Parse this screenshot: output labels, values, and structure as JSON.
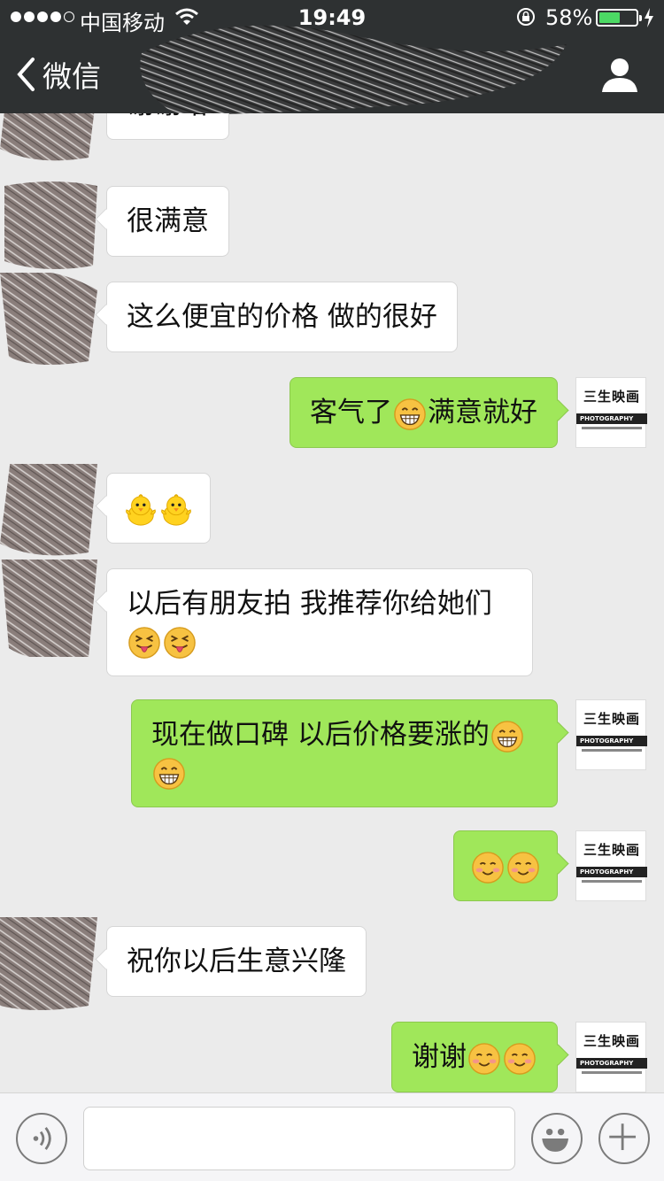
{
  "status": {
    "carrier": "中国移动",
    "time": "19:49",
    "battery_pct": "58%",
    "battery_level": 0.58
  },
  "nav": {
    "back_label": "微信"
  },
  "colors": {
    "nav_bg": "#2e3132",
    "chat_bg": "#ebebeb",
    "bubble_sent": "#a0e75a",
    "bubble_received": "#ffffff"
  },
  "contact_avatar": {
    "logo_title": "三生映画",
    "logo_band": "PHOTOGRAPHY"
  },
  "messages": [
    {
      "side": "left",
      "text": "谢谢哈",
      "emojis": []
    },
    {
      "side": "left",
      "text": "很满意",
      "emojis": []
    },
    {
      "side": "left",
      "text": "这么便宜的价格 做的很好",
      "emojis": []
    },
    {
      "side": "right",
      "text": "客气了",
      "emojis": [
        "grin-icon"
      ],
      "text_after": "满意就好"
    },
    {
      "side": "left",
      "text": "",
      "emojis": [
        "chick-icon",
        "chick-icon"
      ]
    },
    {
      "side": "left",
      "text": " 以后有朋友拍 我推荐你给她们",
      "emojis": [
        "tongue-out-icon",
        "tongue-out-icon"
      ]
    },
    {
      "side": "right",
      "text": "现在做口碑 以后价格要涨的",
      "emojis": [
        "grin-icon",
        "grin-icon"
      ]
    },
    {
      "side": "right",
      "text": "",
      "emojis": [
        "smile-blush-icon",
        "smile-blush-icon"
      ]
    },
    {
      "side": "left",
      "text": " 祝你以后生意兴隆",
      "emojis": []
    },
    {
      "side": "right",
      "text": "谢谢",
      "emojis": [
        "smile-blush-icon",
        "smile-blush-icon"
      ]
    }
  ]
}
